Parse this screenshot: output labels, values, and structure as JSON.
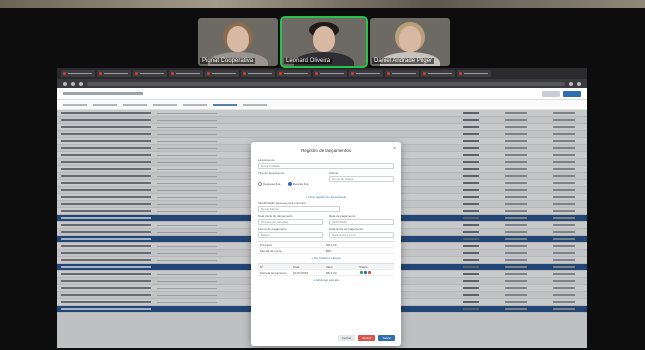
{
  "participants": [
    {
      "name": "Pignat Cooperativa"
    },
    {
      "name": "Leonard Oliveira"
    },
    {
      "name": "Daniel Andrade Pilger"
    }
  ],
  "modal": {
    "title": "Registro de lançamentos",
    "close": "×",
    "fields": [
      {
        "label": "Lançamento",
        "value": "Nova Unidade"
      },
      {
        "label": "Tipo de lançamento",
        "value": ""
      },
      {
        "label": "Cliente",
        "value": "Nome do cliente"
      }
    ],
    "radio": [
      {
        "label": "Despesa fixa",
        "on": false
      },
      {
        "label": "Receita fixa",
        "on": true
      }
    ],
    "link_main": "+ Criar registro de lançamento",
    "ident": {
      "label": "Identificação (apenas para controle)",
      "value": "Nome Fatura"
    },
    "date_left": {
      "label": "Data início do lançamento",
      "value": "Número de parcelas"
    },
    "date_right": {
      "label": "Data de pagamento",
      "value": "01/07/2025"
    },
    "method_left": {
      "label": "Forma de pagamento",
      "value": "Boleto"
    },
    "method_right": {
      "label": "Data limite de pagamento",
      "value": "Data limite e hora"
    },
    "totals": [
      {
        "label": "Principal",
        "value": "R$ 0,00"
      },
      {
        "label": "Moeda da conta",
        "value": "BRL"
      }
    ],
    "link_more": "+ Ver histórico valores",
    "subtable": {
      "head": [
        "Nº",
        "Data",
        "Valor",
        "Status"
      ],
      "row": [
        "Parcela lançamento",
        "01/07/2025",
        "R$ 0,00",
        ""
      ]
    },
    "link_extra": "+ Adicionar parcela",
    "buttons": {
      "cancel": "Fechar",
      "delete": "Excluir",
      "save": "Salvar"
    }
  }
}
